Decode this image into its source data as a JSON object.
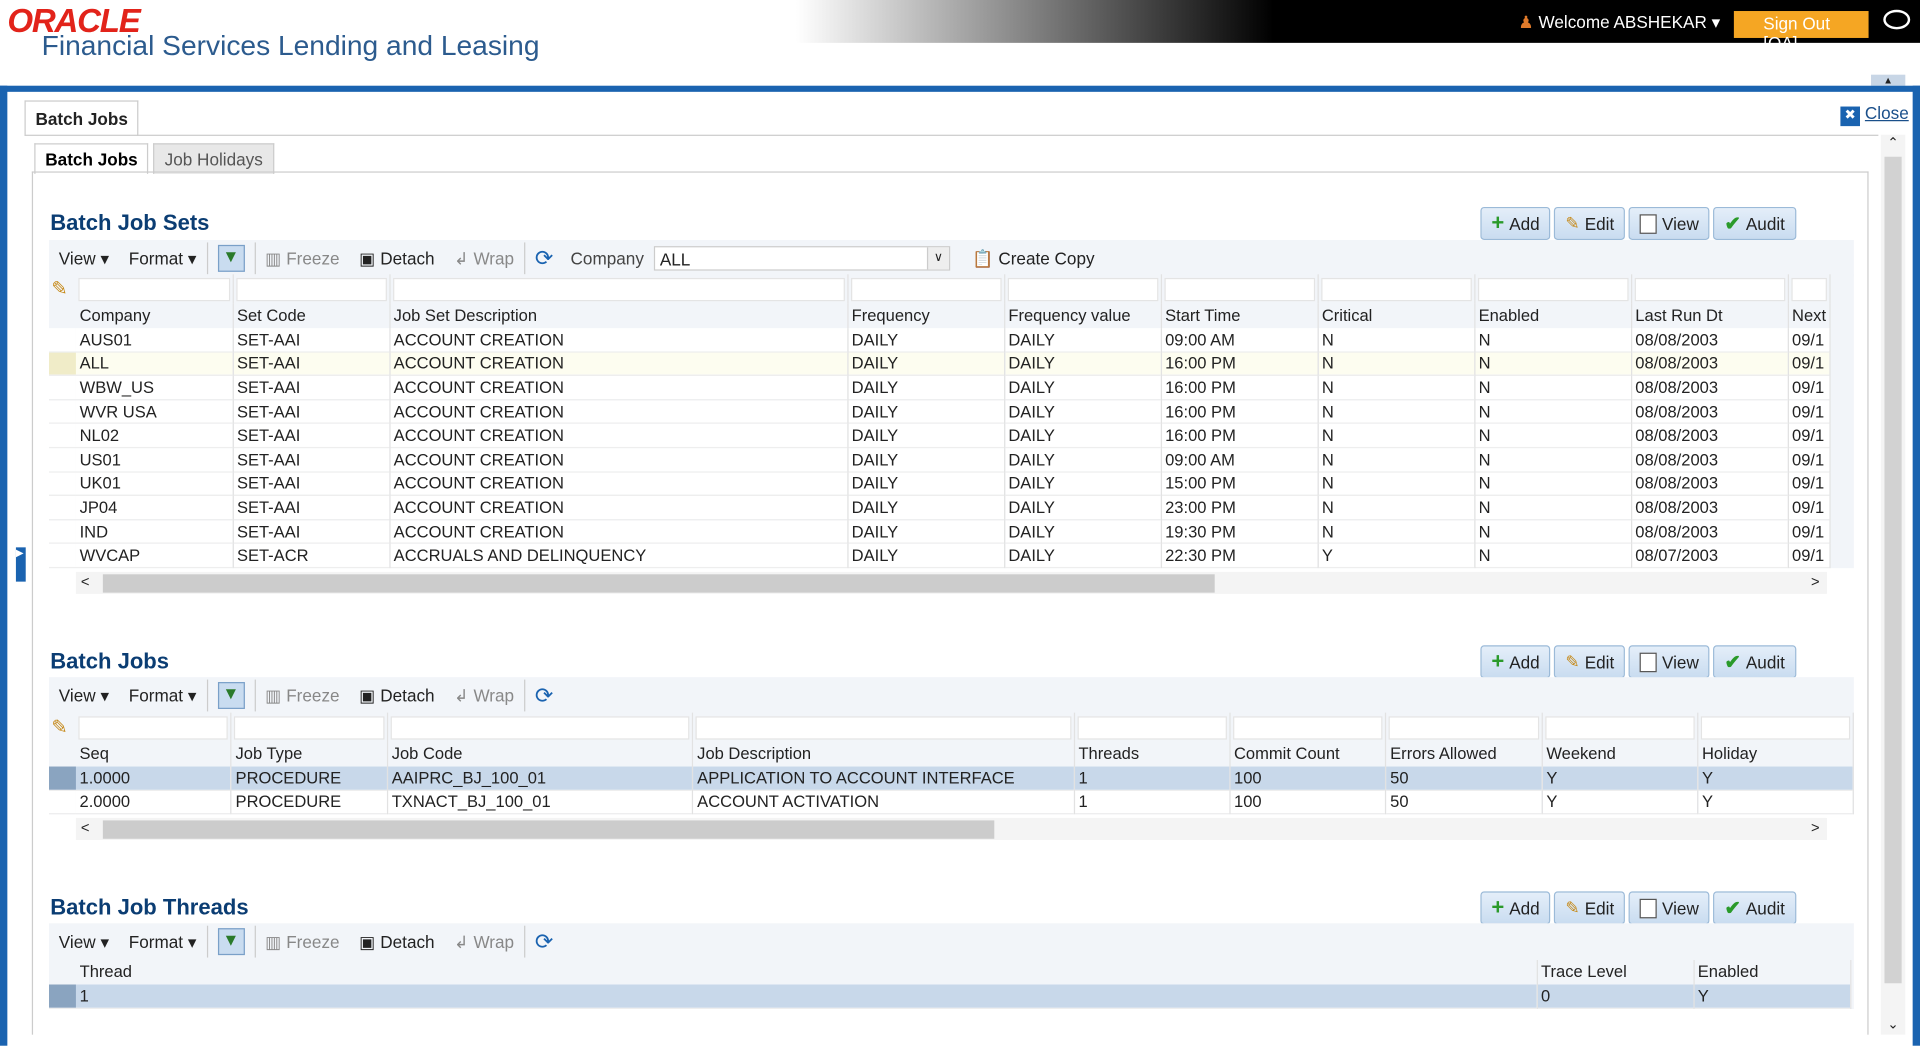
{
  "header": {
    "logo": "ORACLE",
    "app_name": "Financial Services Lending and Leasing",
    "welcome": "Welcome ABSHEKAR",
    "sign_out": "Sign Out [QA]"
  },
  "page": {
    "tab": "Batch Jobs",
    "close": "Close",
    "tabs": [
      {
        "label": "Batch Jobs",
        "active": true
      },
      {
        "label": "Job Holidays",
        "active": false
      }
    ]
  },
  "buttons": {
    "add": "Add",
    "edit": "Edit",
    "view": "View",
    "audit": "Audit"
  },
  "toolbar": {
    "view": "View",
    "format": "Format",
    "freeze": "Freeze",
    "detach": "Detach",
    "wrap": "Wrap",
    "company_label": "Company",
    "company_value": "ALL",
    "create_copy": "Create Copy"
  },
  "job_sets": {
    "title": "Batch Job Sets",
    "columns": [
      "Company",
      "Set Code",
      "Job Set Description",
      "Frequency",
      "Frequency value",
      "Start Time",
      "Critical",
      "Enabled",
      "Last Run Dt",
      "Next"
    ],
    "rows": [
      [
        "AUS01",
        "SET-AAI",
        "ACCOUNT CREATION",
        "DAILY",
        "DAILY",
        "09:00 AM",
        "N",
        "N",
        "08/08/2003",
        "09/1"
      ],
      [
        "ALL",
        "SET-AAI",
        "ACCOUNT CREATION",
        "DAILY",
        "DAILY",
        "16:00 PM",
        "N",
        "N",
        "08/08/2003",
        "09/1"
      ],
      [
        "WBW_US",
        "SET-AAI",
        "ACCOUNT CREATION",
        "DAILY",
        "DAILY",
        "16:00 PM",
        "N",
        "N",
        "08/08/2003",
        "09/1"
      ],
      [
        "WVR USA",
        "SET-AAI",
        "ACCOUNT CREATION",
        "DAILY",
        "DAILY",
        "16:00 PM",
        "N",
        "N",
        "08/08/2003",
        "09/1"
      ],
      [
        "NL02",
        "SET-AAI",
        "ACCOUNT CREATION",
        "DAILY",
        "DAILY",
        "16:00 PM",
        "N",
        "N",
        "08/08/2003",
        "09/1"
      ],
      [
        "US01",
        "SET-AAI",
        "ACCOUNT CREATION",
        "DAILY",
        "DAILY",
        "09:00 AM",
        "N",
        "N",
        "08/08/2003",
        "09/1"
      ],
      [
        "UK01",
        "SET-AAI",
        "ACCOUNT CREATION",
        "DAILY",
        "DAILY",
        "15:00 PM",
        "N",
        "N",
        "08/08/2003",
        "09/1"
      ],
      [
        "JP04",
        "SET-AAI",
        "ACCOUNT CREATION",
        "DAILY",
        "DAILY",
        "23:00 PM",
        "N",
        "N",
        "08/08/2003",
        "09/1"
      ],
      [
        "IND",
        "SET-AAI",
        "ACCOUNT CREATION",
        "DAILY",
        "DAILY",
        "19:30 PM",
        "N",
        "N",
        "08/08/2003",
        "09/1"
      ],
      [
        "WVCAP",
        "SET-ACR",
        "ACCRUALS AND DELINQUENCY",
        "DAILY",
        "DAILY",
        "22:30 PM",
        "Y",
        "N",
        "08/07/2003",
        "09/1"
      ]
    ]
  },
  "jobs": {
    "title": "Batch Jobs",
    "columns": [
      "Seq",
      "Job Type",
      "Job Code",
      "Job Description",
      "Threads",
      "Commit Count",
      "Errors Allowed",
      "Weekend",
      "Holiday"
    ],
    "rows": [
      [
        "1.0000",
        "PROCEDURE",
        "AAIPRC_BJ_100_01",
        "APPLICATION TO ACCOUNT INTERFACE",
        "1",
        "100",
        "50",
        "Y",
        "Y"
      ],
      [
        "2.0000",
        "PROCEDURE",
        "TXNACT_BJ_100_01",
        "ACCOUNT ACTIVATION",
        "1",
        "100",
        "50",
        "Y",
        "Y"
      ]
    ]
  },
  "threads": {
    "title": "Batch Job Threads",
    "columns": [
      "Thread",
      "Trace Level",
      "Enabled"
    ],
    "rows": [
      [
        "1",
        "0",
        "Y"
      ]
    ]
  }
}
